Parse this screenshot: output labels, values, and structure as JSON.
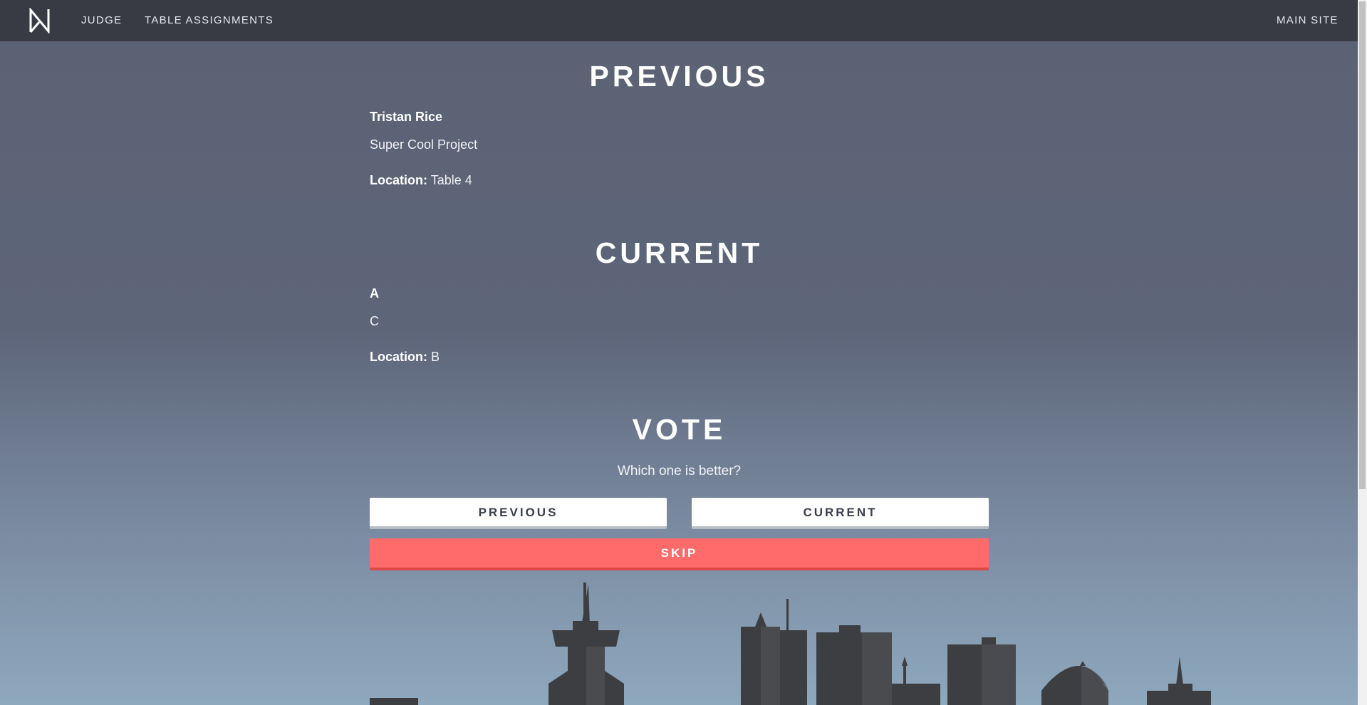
{
  "nav": {
    "judge": "JUDGE",
    "table_assignments": "TABLE ASSIGNMENTS",
    "main_site": "MAIN SITE"
  },
  "previous": {
    "heading": "PREVIOUS",
    "name": "Tristan Rice",
    "description": "Super Cool Project",
    "location_label": "Location:",
    "location": "Table 4"
  },
  "current": {
    "heading": "CURRENT",
    "name": "A",
    "description": "C",
    "location_label": "Location:",
    "location": "B"
  },
  "vote": {
    "heading": "VOTE",
    "question": "Which one is better?",
    "previous_button": "PREVIOUS",
    "current_button": "CURRENT",
    "skip_button": "SKIP"
  },
  "colors": {
    "navbar": "#383a44",
    "skip": "#ff6b6b",
    "skyline": "#3d3e42"
  },
  "icons": {
    "logo": "n-logo-icon"
  }
}
